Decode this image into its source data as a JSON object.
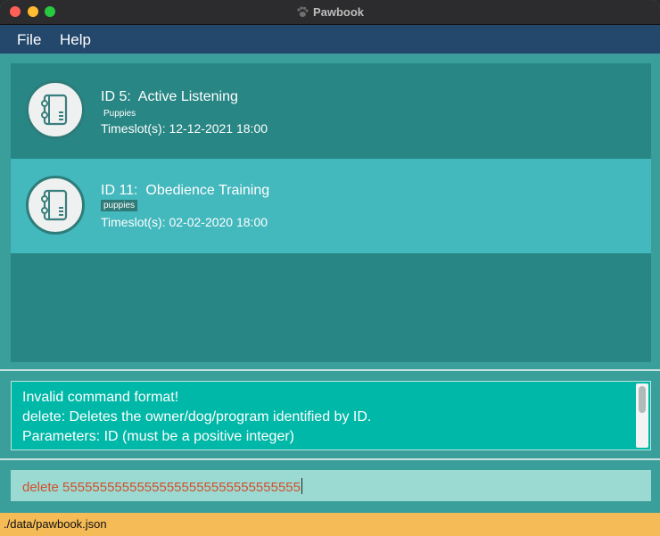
{
  "window": {
    "title": "Pawbook",
    "app_icon": "paw-icon"
  },
  "menu": {
    "file": "File",
    "help": "Help"
  },
  "programs": [
    {
      "id_label": "ID 5:  Active Listening",
      "tag": "Puppies",
      "timeslot": "Timeslot(s): 12-12-2021 18:00"
    },
    {
      "id_label": "ID 11:  Obedience Training",
      "tag": "puppies",
      "timeslot": "Timeslot(s): 02-02-2020 18:00"
    }
  ],
  "result": {
    "line1": "Invalid command format!",
    "line2": "delete: Deletes the owner/dog/program identified by ID.",
    "line3": "Parameters: ID (must be a positive integer)"
  },
  "command": {
    "value": "delete 55555555555555555555555555555555"
  },
  "status": {
    "path": "./data/pawbook.json"
  },
  "colors": {
    "accent": "#24476c",
    "result_bg": "#00b8a8",
    "error_text": "#d2502c",
    "status_bg": "#f5bb56"
  }
}
